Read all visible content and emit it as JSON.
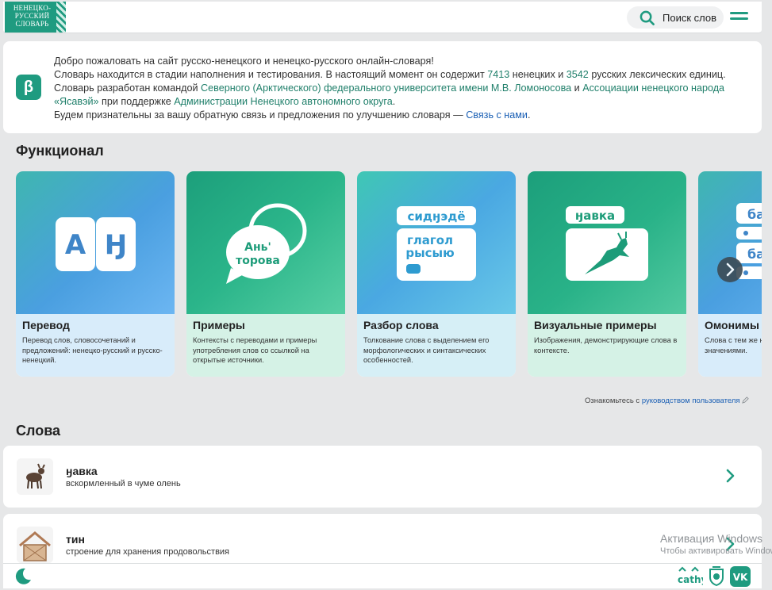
{
  "header": {
    "logo_line1": "НЕНЕЦКО-",
    "logo_line2": "РУССКИЙ",
    "logo_line3": "СЛОВАРЬ",
    "search_label": "Поиск слов"
  },
  "welcome": {
    "badge": "β",
    "line1": "Добро пожаловать на сайт русско-ненецкого и ненецко-русского онлайн-словаря!",
    "line2_a": "Словарь находится в стадии наполнения и тестирования. В настоящий момент он содержит ",
    "nenets_count": "7413",
    "line2_b": " ненецких и ",
    "russian_count": "3542",
    "line2_c": " русских лексических единиц.",
    "line3_a": "Словарь разработан командой ",
    "university": "Северного (Арктического) федерального университета имени М.В. Ломоносова",
    "line3_b": " и ",
    "association": "Ассоциации ненецкого народа",
    "yasavey": "«Ясавэй»",
    "line4_b": " при поддержке ",
    "administration": "Администрации Ненецкого автономного округа",
    "line4_c": ".",
    "line5_a": "Будем признательны за вашу обратную связь и предложения по улучшению словаря — ",
    "contact": "Связь с нами",
    "line5_b": "."
  },
  "functional": {
    "title": "Функционал",
    "cards": [
      {
        "title": "Перевод",
        "desc": "Перевод слов, словосочетаний и предложений: ненецко-русский и русско-ненецкий.",
        "art_a": "А",
        "art_b": "Ӈ"
      },
      {
        "title": "Примеры",
        "desc": "Контексты с переводами и примеры употребления слов со ссылкой на открытые источники.",
        "art_a": "Ань'",
        "art_b": "торова"
      },
      {
        "title": "Разбор слова",
        "desc": "Толкование слова с выделением его морфологических и синтаксических особенностей.",
        "art_a": "сидӈэдё",
        "art_b": "глагол",
        "art_c": "рысыю"
      },
      {
        "title": "Визуальные примеры",
        "desc": "Изображения, демонстрирующие слова в контексте.",
        "art_a": "ӈавка"
      },
      {
        "title": "Омонимы",
        "desc": "Слова с тем же написанием, но разными значениями.",
        "art_a": "ба",
        "art_b": "ба"
      }
    ]
  },
  "guide": {
    "prefix": "Ознакомьтесь с ",
    "link": "руководством пользователя",
    "icon": "pencil-icon"
  },
  "words": {
    "title": "Слова",
    "items": [
      {
        "word": "ӈавка",
        "desc": "вскормленный в чуме олень",
        "icon": "fawn-icon"
      },
      {
        "word": "тин",
        "desc": "строение для хранения продовольствия",
        "icon": "storehouse-icon"
      }
    ]
  },
  "watermark": {
    "line1": "Активация Windows",
    "line2": "Чтобы активировать Windows"
  },
  "footer": {
    "theme_icon": "moon-icon",
    "icons": [
      "cathy-logo-icon",
      "emblem-icon",
      "vk-icon"
    ]
  },
  "colors": {
    "brand": "#1f9b80",
    "link": "#1f7f6a",
    "contact_link": "#1a5fb4"
  }
}
